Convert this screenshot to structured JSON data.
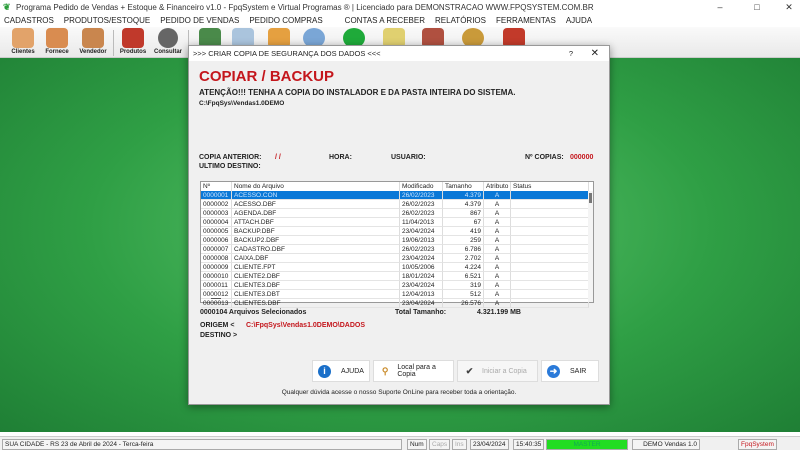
{
  "window": {
    "title": "Programa Pedido de Vendas + Estoque & Financeiro v1.0 - FpqSystem e Virtual Programas ® | Licenciado para  DEMONSTRACAO WWW.FPQSYSTEM.COM.BR",
    "minimize": "–",
    "maximize": "□",
    "close": "✕"
  },
  "menu": [
    "CADASTROS",
    "PRODUTOS/ESTOQUE",
    "PEDIDO DE VENDAS",
    "PEDIDO COMPRAS",
    "CONTAS A RECEBER",
    "RELATÓRIOS",
    "FERRAMENTAS",
    "AJUDA"
  ],
  "toolbar": [
    {
      "label": "Clientes",
      "icon": "clients-icon"
    },
    {
      "label": "Fornece",
      "icon": "supplier-icon"
    },
    {
      "label": "Vendedor",
      "icon": "seller-icon"
    },
    {
      "label": "Produtos",
      "icon": "products-icon"
    },
    {
      "label": "Consultar",
      "icon": "barcode-icon"
    }
  ],
  "dialog": {
    "title": ">>> CRIAR COPIA DE SEGURANÇA DOS DADOS <<<",
    "help": "?",
    "close": "✕",
    "heading": "COPIAR / BACKUP",
    "warning": "ATENÇÃO!!!  TENHA A COPIA DO  INSTALADOR  E  DA PASTA INTEIRA DO  SISTEMA.",
    "path": "C:\\FpqSys\\Vendas1.0DEMO",
    "copia_anterior_label": "COPIA ANTERIOR:",
    "copia_anterior_value": "/ /",
    "hora_label": "HORA:",
    "usuario_label": "USUARIO:",
    "ncopias_label": "Nº COPIAS:",
    "ncopias_value": "000000",
    "ultimo_destino_label": "ULTIMO DESTINO:",
    "columns": [
      "Nº",
      "Nome do Arquivo",
      "Modificado",
      "Tamanho",
      "Atributo",
      "Status"
    ],
    "rows": [
      [
        "0000001",
        "ACESSO.CON",
        "26/02/2023",
        "4.379",
        "A",
        ""
      ],
      [
        "0000002",
        "ACESSO.DBF",
        "26/02/2023",
        "4.379",
        "A",
        ""
      ],
      [
        "0000003",
        "AGENDA.DBF",
        "26/02/2023",
        "867",
        "A",
        ""
      ],
      [
        "0000004",
        "ATTACH.DBF",
        "11/04/2013",
        "67",
        "A",
        ""
      ],
      [
        "0000005",
        "BACKUP.DBF",
        "23/04/2024",
        "419",
        "A",
        ""
      ],
      [
        "0000006",
        "BACKUP2.DBF",
        "19/06/2013",
        "259",
        "A",
        ""
      ],
      [
        "0000007",
        "CADASTRO.DBF",
        "26/02/2023",
        "6.786",
        "A",
        ""
      ],
      [
        "0000008",
        "CAIXA.DBF",
        "23/04/2024",
        "2.702",
        "A",
        ""
      ],
      [
        "0000009",
        "CLIENTE.FPT",
        "10/05/2006",
        "4.224",
        "A",
        ""
      ],
      [
        "0000010",
        "CLIENTE2.DBF",
        "18/01/2024",
        "6.521",
        "A",
        ""
      ],
      [
        "0000011",
        "CLIENTE3.DBF",
        "23/04/2024",
        "319",
        "A",
        ""
      ],
      [
        "0000012",
        "CLIENTE3.DBT",
        "12/04/2013",
        "512",
        "A",
        ""
      ],
      [
        "0000013",
        "CLIENTES.DBF",
        "23/04/2024",
        "26.576",
        "A",
        ""
      ]
    ],
    "selected_count": "0000104 Arquivos  Selecionados",
    "total_label": "Total Tamanho:",
    "total_value": "4.321.199 MB",
    "origem_label": "ORIGEM  <",
    "origem_value": "C:\\FpqSys\\Vendas1.0DEMO\\DADOS",
    "destino_label": "DESTINO >",
    "buttons": {
      "ajuda": "AJUDA",
      "local": "Local para a Copia",
      "iniciar": "Iniciar a Copia",
      "sair": "SAIR"
    },
    "footer": "Qualquer dúvida acesse o nosso Suporte OnLine para receber toda a orientação."
  },
  "statusbar": {
    "city": "SUA CIDADE - RS 23 de Abril de 2024 - Terca-feira",
    "num": "Num",
    "caps": "Caps",
    "ins": "Ins",
    "date": "23/04/2024",
    "time": "15:40:35",
    "user": "MASTER",
    "version": "DEMO Vendas 1.0",
    "brand": "FpqSystem"
  },
  "colors": {
    "accent_red": "#c4161c",
    "selection": "#0a78d7",
    "green": "#2f9f45"
  }
}
